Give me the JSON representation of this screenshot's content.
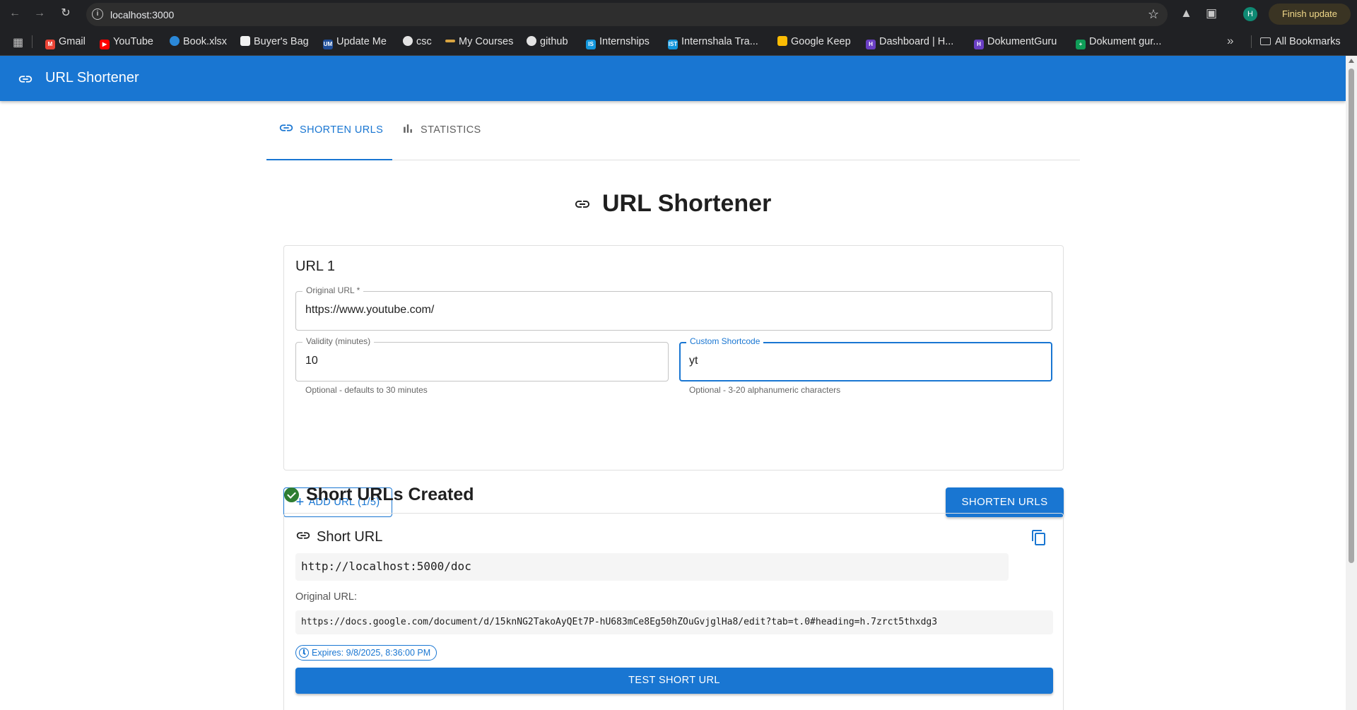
{
  "browser": {
    "url": "localhost:3000",
    "update_label": "Finish update",
    "profile_initial": "H",
    "bookmarks": [
      {
        "label": "Gmail",
        "icon": "gmail-icon",
        "color": "#ea4335"
      },
      {
        "label": "YouTube",
        "icon": "youtube-icon",
        "color": "#ff0000"
      },
      {
        "label": "Book.xlsx",
        "icon": "onedrive-icon",
        "color": "#2b88d8"
      },
      {
        "label": "Buyer's Bag",
        "icon": "page-icon",
        "color": "#f1f1f1"
      },
      {
        "label": "Update Me",
        "icon": "um-icon",
        "color": "#1f4e99"
      },
      {
        "label": "csc",
        "icon": "github-icon",
        "color": "#e3e3e3"
      },
      {
        "label": "My Courses",
        "icon": "courses-icon",
        "color": "#d9a441"
      },
      {
        "label": "github",
        "icon": "github-icon",
        "color": "#e3e3e3"
      },
      {
        "label": "Internships",
        "icon": "internshala-icon",
        "color": "#1296db"
      },
      {
        "label": "Internshala Tra...",
        "icon": "internshala-training-icon",
        "color": "#1296db"
      },
      {
        "label": "Google Keep",
        "icon": "keep-icon",
        "color": "#fbbc04"
      },
      {
        "label": "Dashboard | H...",
        "icon": "hackerrank-icon",
        "color": "#6a3fc4"
      },
      {
        "label": "DokumentGuru",
        "icon": "dokument-icon",
        "color": "#6a3fc4"
      },
      {
        "label": "Dokument gur...",
        "icon": "sheets-icon",
        "color": "#0f9d58"
      }
    ],
    "all_bookmarks_label": "All Bookmarks"
  },
  "app": {
    "title": "URL Shortener",
    "accent": "#1976d2",
    "tabs": [
      {
        "label": "SHORTEN URLS",
        "icon": "link-icon",
        "active": true
      },
      {
        "label": "STATISTICS",
        "icon": "bar-chart-icon",
        "active": false
      }
    ],
    "heading": "URL Shortener"
  },
  "form": {
    "card_title": "URL 1",
    "original_url": {
      "label": "Original URL *",
      "value": "https://www.youtube.com/"
    },
    "validity": {
      "label": "Validity (minutes)",
      "value": "10",
      "helper": "Optional - defaults to 30 minutes"
    },
    "shortcode": {
      "label": "Custom Shortcode",
      "value": "yt",
      "helper": "Optional - 3-20 alphanumeric characters"
    },
    "add_button": "ADD URL (1/5)",
    "shorten_button": "SHORTEN URLS"
  },
  "results": {
    "heading": "Short URLs Created",
    "items": [
      {
        "title": "Short URL",
        "short_url": "http://localhost:5000/doc",
        "original_label": "Original URL:",
        "original_url": "https://docs.google.com/document/d/15knNG2TakoAyQEt7P-hU683mCe8Eg50hZOuGvjglHa8/edit?tab=t.0#heading=h.7zrct5thxdg3",
        "expires": "Expires: 9/8/2025, 8:36:00 PM",
        "test_button": "TEST SHORT URL"
      }
    ]
  }
}
